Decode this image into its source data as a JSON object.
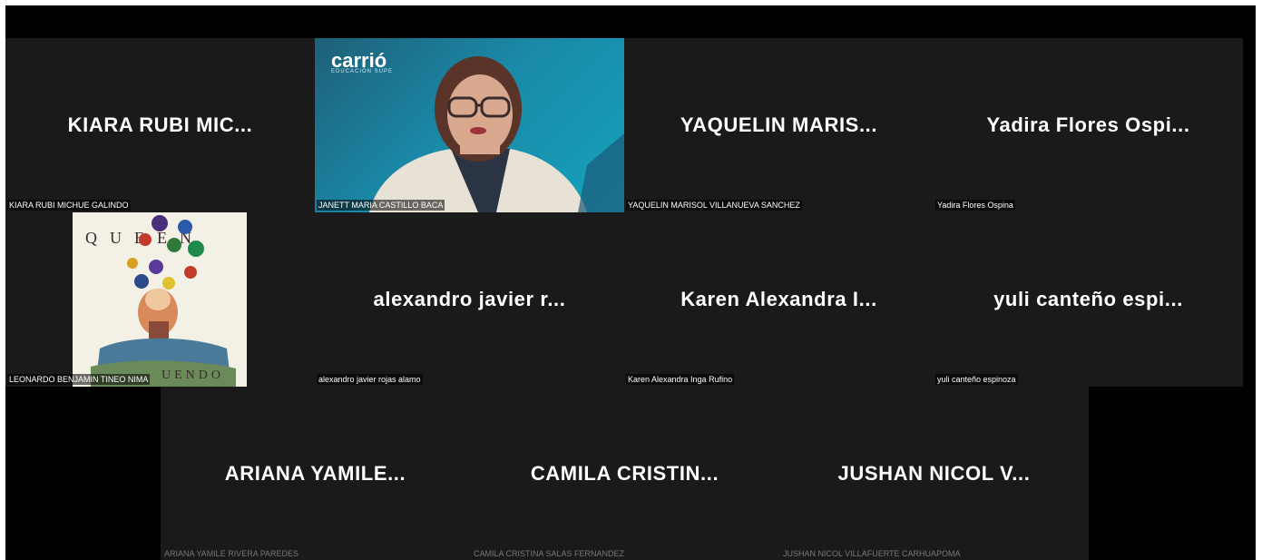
{
  "participants": [
    {
      "display": "KIARA RUBI MIC...",
      "full_name": "KIARA RUBI MICHUE GALINDO"
    },
    {
      "display": "",
      "full_name": "JANETT MARIA CASTILLO BACA",
      "video": true,
      "logo_text": "carrió",
      "logo_sub": "EDUCACIÓN SUPE"
    },
    {
      "display": "YAQUELIN MARIS...",
      "full_name": "YAQUELIN MARISOL VILLANUEVA SANCHEZ"
    },
    {
      "display": "Yadira Flores Ospi...",
      "full_name": "Yadira Flores Ospina"
    },
    {
      "display": "",
      "full_name": "LEONARDO BENJAMIN TINEO NIMA",
      "album": true,
      "album_top": "QUEEN",
      "album_bottom": "UENDO"
    },
    {
      "display": "alexandro javier r...",
      "full_name": "alexandro javier rojas alamo"
    },
    {
      "display": "Karen Alexandra I...",
      "full_name": "Karen Alexandra Inga Rufino"
    },
    {
      "display": "yuli canteño espi...",
      "full_name": "yuli canteño espinoza"
    },
    {
      "display": "ARIANA YAMILE...",
      "full_name": "ARIANA YAMILE RIVERA PAREDES"
    },
    {
      "display": "CAMILA CRISTIN...",
      "full_name": "CAMILA CRISTINA SALAS FERNANDEZ"
    },
    {
      "display": "JUSHAN NICOL V...",
      "full_name": "JUSHAN NICOL VILLAFUERTE CARHUAPOMA"
    }
  ],
  "colors": {
    "tile_bg": "#1a1a1a",
    "app_bg": "#000000",
    "text": "#ffffff"
  }
}
